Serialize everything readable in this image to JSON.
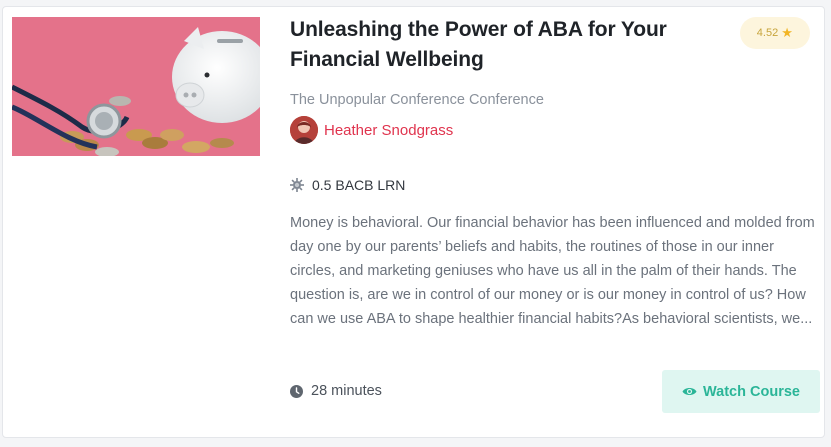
{
  "course": {
    "title": "Unleashing the Power of ABA for Your Financial Wellbeing",
    "rating": "4.52",
    "conference": "The Unpopular Conference Conference",
    "author": "Heather Snodgrass",
    "credits": "0.5 BACB LRN",
    "description": "Money is behavioral. Our financial behavior has been influenced and molded from day one by our parents’ beliefs and habits, the routines of those in our inner circles, and marketing geniuses who have us all in the palm of their hands. The question is, are we in control of our money or is our money in control of us? How can we use ABA to shape healthier financial habits?As behavioral scientists, we...",
    "duration": "28 minutes",
    "watch_label": "Watch Course"
  },
  "icons": {
    "rating": "star-icon",
    "credits": "gear-badge-icon",
    "duration": "clock-icon",
    "watch": "eye-icon"
  },
  "colors": {
    "accent": "#2bb598",
    "author": "#e0344e",
    "rating_bg": "#fdf5dd",
    "star": "#f2b526"
  }
}
